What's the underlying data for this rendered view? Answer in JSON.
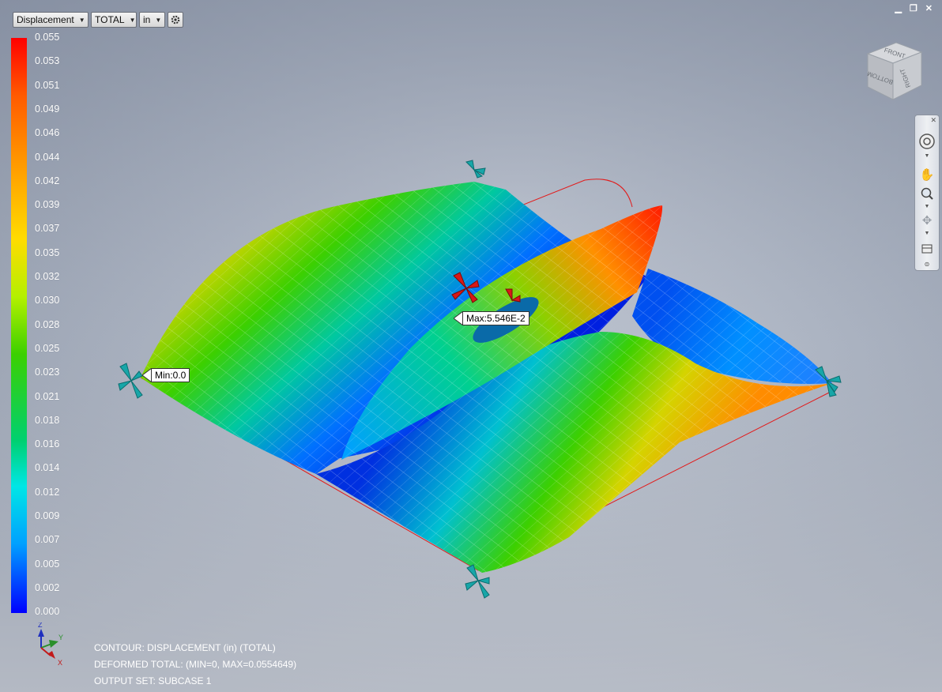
{
  "toolbar": {
    "result_type": "Displacement",
    "component": "TOTAL",
    "units": "in",
    "settings_icon": "gear-icon"
  },
  "legend": {
    "values": [
      "0.055",
      "0.053",
      "0.051",
      "0.049",
      "0.046",
      "0.044",
      "0.042",
      "0.039",
      "0.037",
      "0.035",
      "0.032",
      "0.030",
      "0.028",
      "0.025",
      "0.023",
      "0.021",
      "0.018",
      "0.016",
      "0.014",
      "0.012",
      "0.009",
      "0.007",
      "0.005",
      "0.002",
      "0.000"
    ],
    "colors": [
      "#ff0000",
      "#ff9a00",
      "#ffdc00",
      "#3cd000",
      "#00e6e6",
      "#0000ff"
    ]
  },
  "markers": {
    "min": "Min:0.0",
    "max": "Max:5.546E-2"
  },
  "info": {
    "line1": "CONTOUR: DISPLACEMENT (in) (TOTAL)",
    "line2": "DEFORMED TOTAL: (MIN=0, MAX=0.0554649)",
    "line3": "OUTPUT SET: SUBCASE 1"
  },
  "view_cube": {
    "faces": [
      "FRONT",
      "RIGHT",
      "BOTTOM"
    ]
  },
  "window_controls": [
    "minimize-icon",
    "restore-icon",
    "close-icon"
  ],
  "navbar": {
    "tools": [
      "full-navigation-wheel-icon",
      "pan-icon",
      "zoom-icon",
      "orbit-icon",
      "look-at-icon"
    ]
  },
  "triad": {
    "axes": [
      "Z",
      "Y",
      "X"
    ]
  }
}
